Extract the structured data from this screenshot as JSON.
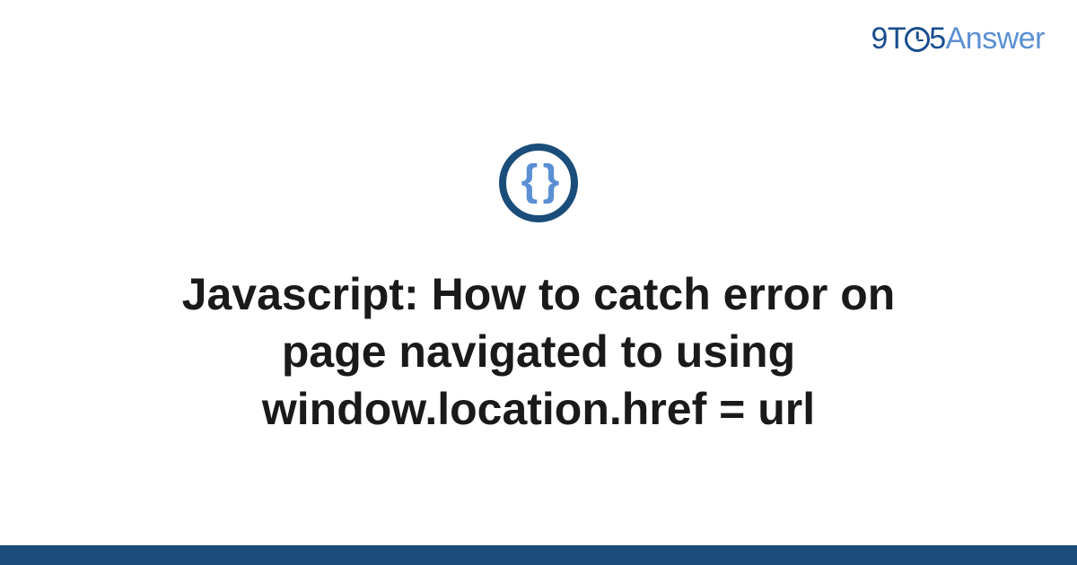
{
  "logo": {
    "part1": "9T",
    "part2": "5",
    "part3": "Answer"
  },
  "topic_icon": {
    "symbol": "{ }",
    "name": "javascript-braces"
  },
  "title": "Javascript: How to catch error on page navigated to using window.location.href = url",
  "colors": {
    "brand_dark": "#1a4d7a",
    "brand_blue": "#1a4d8f",
    "brand_light": "#5a8fd4",
    "text": "#1a1a1a"
  }
}
